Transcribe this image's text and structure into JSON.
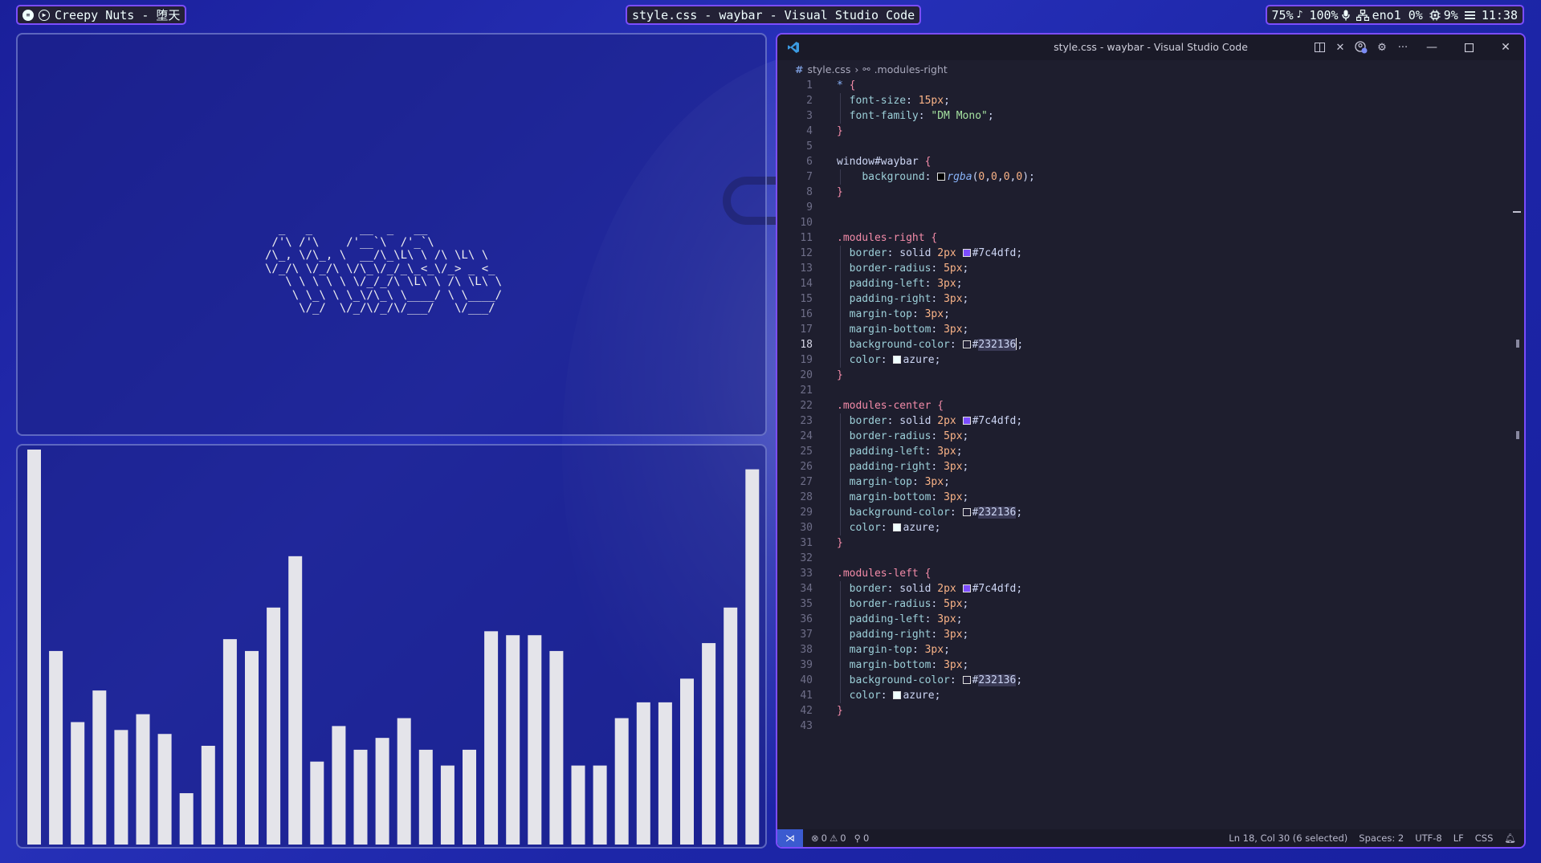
{
  "topbar": {
    "media": {
      "text": "Creepy Nuts - 堕天"
    },
    "window_title": "style.css - waybar - Visual Studio Code",
    "modules": {
      "pulse": "75%",
      "pulse_icon": "♪",
      "mic": "100%",
      "network": "eno1 0%",
      "cpu": "9%",
      "clock": "11:38"
    }
  },
  "ascii_pane": {
    "art": "  _   _       __  _   __ \n /'\\ /'\\    /'__`\\  /'_`\\ \n/\\_, \\/\\_, \\  __/\\_\\L\\ \\ /\\ \\L\\ \\\n\\/_/\\ \\/_/\\ \\/\\_\\/_/_\\_<_\\/_> _ <_\n   \\ \\ \\ \\ \\ \\/_/_/\\ \\L\\ \\ /\\ \\L\\ \\\n    \\ \\_\\ \\ \\_\\/\\_\\ \\____/ \\ \\____/\n     \\/_/  \\/_/\\/_/\\/___/   \\/___/"
  },
  "cava": {
    "bar_color": "#e4e4ea",
    "levels": [
      1.0,
      0.49,
      0.31,
      0.39,
      0.29,
      0.33,
      0.28,
      0.13,
      0.25,
      0.52,
      0.49,
      0.6,
      0.73,
      0.21,
      0.3,
      0.24,
      0.27,
      0.32,
      0.24,
      0.2,
      0.24,
      0.54,
      0.53,
      0.53,
      0.49,
      0.2,
      0.2,
      0.32,
      0.36,
      0.36,
      0.42,
      0.51,
      0.6,
      0.95
    ]
  },
  "vscode": {
    "title": "style.css - waybar - Visual Studio Code",
    "breadcrumb": {
      "file": "style.css",
      "symbol": ".modules-right"
    },
    "status": {
      "errors": "0",
      "warnings": "0",
      "ports": "0",
      "position": "Ln 18, Col 30 (6 selected)",
      "spaces": "Spaces: 2",
      "encoding": "UTF-8",
      "eol": "LF",
      "language": "CSS"
    },
    "active_line": 18,
    "lines": [
      [
        [
          "t-star",
          "*"
        ],
        [
          "t-punc",
          " "
        ],
        [
          "t-brace",
          "{"
        ]
      ],
      [
        [
          "t-punc",
          "  "
        ],
        [
          "t-prop",
          "font-size"
        ],
        [
          "t-punc",
          ": "
        ],
        [
          "t-num",
          "15px"
        ],
        [
          "t-punc",
          ";"
        ]
      ],
      [
        [
          "t-punc",
          "  "
        ],
        [
          "t-prop",
          "font-family"
        ],
        [
          "t-punc",
          ": "
        ],
        [
          "t-str",
          "\"DM Mono\""
        ],
        [
          "t-punc",
          ";"
        ]
      ],
      [
        [
          "t-brace",
          "}"
        ]
      ],
      [],
      [
        [
          "t-kw",
          "window#waybar "
        ],
        [
          "t-brace",
          "{"
        ]
      ],
      [
        [
          "t-punc",
          "    "
        ],
        [
          "t-prop",
          "background"
        ],
        [
          "t-punc",
          ": "
        ],
        [
          "swatch",
          "#000000"
        ],
        [
          "t-fn",
          "rgba"
        ],
        [
          "t-punc",
          "("
        ],
        [
          "t-num",
          "0"
        ],
        [
          "t-punc",
          ","
        ],
        [
          "t-num",
          "0"
        ],
        [
          "t-punc",
          ","
        ],
        [
          "t-num",
          "0"
        ],
        [
          "t-punc",
          ","
        ],
        [
          "t-num",
          "0"
        ],
        [
          "t-punc",
          ");"
        ]
      ],
      [
        [
          "t-brace",
          "}"
        ]
      ],
      [],
      [],
      [
        [
          "t-sel",
          ".modules-right "
        ],
        [
          "t-brace",
          "{"
        ]
      ],
      [
        [
          "t-punc",
          "  "
        ],
        [
          "t-prop",
          "border"
        ],
        [
          "t-punc",
          ": solid "
        ],
        [
          "t-num",
          "2px"
        ],
        [
          "t-punc",
          " "
        ],
        [
          "swatch",
          "#7c4dfd"
        ],
        [
          "t-punc",
          "#7c4dfd;"
        ]
      ],
      [
        [
          "t-punc",
          "  "
        ],
        [
          "t-prop",
          "border-radius"
        ],
        [
          "t-punc",
          ": "
        ],
        [
          "t-num",
          "5px"
        ],
        [
          "t-punc",
          ";"
        ]
      ],
      [
        [
          "t-punc",
          "  "
        ],
        [
          "t-prop",
          "padding-left"
        ],
        [
          "t-punc",
          ": "
        ],
        [
          "t-num",
          "3px"
        ],
        [
          "t-punc",
          ";"
        ]
      ],
      [
        [
          "t-punc",
          "  "
        ],
        [
          "t-prop",
          "padding-right"
        ],
        [
          "t-punc",
          ": "
        ],
        [
          "t-num",
          "3px"
        ],
        [
          "t-punc",
          ";"
        ]
      ],
      [
        [
          "t-punc",
          "  "
        ],
        [
          "t-prop",
          "margin-top"
        ],
        [
          "t-punc",
          ": "
        ],
        [
          "t-num",
          "3px"
        ],
        [
          "t-punc",
          ";"
        ]
      ],
      [
        [
          "t-punc",
          "  "
        ],
        [
          "t-prop",
          "margin-bottom"
        ],
        [
          "t-punc",
          ": "
        ],
        [
          "t-num",
          "3px"
        ],
        [
          "t-punc",
          ";"
        ]
      ],
      [
        [
          "t-punc",
          "  "
        ],
        [
          "t-prop",
          "background-color"
        ],
        [
          "t-punc",
          ": "
        ],
        [
          "swatch",
          "#232136"
        ],
        [
          "t-punc",
          "#"
        ],
        [
          "t-hl",
          "232136"
        ],
        [
          "cursor",
          ""
        ],
        [
          "t-punc",
          ";"
        ]
      ],
      [
        [
          "t-punc",
          "  "
        ],
        [
          "t-prop",
          "color"
        ],
        [
          "t-punc",
          ": "
        ],
        [
          "swatch",
          "#f0ffff"
        ],
        [
          "t-punc",
          "azure;"
        ]
      ],
      [
        [
          "t-brace",
          "}"
        ]
      ],
      [],
      [
        [
          "t-sel",
          ".modules-center "
        ],
        [
          "t-brace",
          "{"
        ]
      ],
      [
        [
          "t-punc",
          "  "
        ],
        [
          "t-prop",
          "border"
        ],
        [
          "t-punc",
          ": solid "
        ],
        [
          "t-num",
          "2px"
        ],
        [
          "t-punc",
          " "
        ],
        [
          "swatch",
          "#7c4dfd"
        ],
        [
          "t-punc",
          "#7c4dfd;"
        ]
      ],
      [
        [
          "t-punc",
          "  "
        ],
        [
          "t-prop",
          "border-radius"
        ],
        [
          "t-punc",
          ": "
        ],
        [
          "t-num",
          "5px"
        ],
        [
          "t-punc",
          ";"
        ]
      ],
      [
        [
          "t-punc",
          "  "
        ],
        [
          "t-prop",
          "padding-left"
        ],
        [
          "t-punc",
          ": "
        ],
        [
          "t-num",
          "3px"
        ],
        [
          "t-punc",
          ";"
        ]
      ],
      [
        [
          "t-punc",
          "  "
        ],
        [
          "t-prop",
          "padding-right"
        ],
        [
          "t-punc",
          ": "
        ],
        [
          "t-num",
          "3px"
        ],
        [
          "t-punc",
          ";"
        ]
      ],
      [
        [
          "t-punc",
          "  "
        ],
        [
          "t-prop",
          "margin-top"
        ],
        [
          "t-punc",
          ": "
        ],
        [
          "t-num",
          "3px"
        ],
        [
          "t-punc",
          ";"
        ]
      ],
      [
        [
          "t-punc",
          "  "
        ],
        [
          "t-prop",
          "margin-bottom"
        ],
        [
          "t-punc",
          ": "
        ],
        [
          "t-num",
          "3px"
        ],
        [
          "t-punc",
          ";"
        ]
      ],
      [
        [
          "t-punc",
          "  "
        ],
        [
          "t-prop",
          "background-color"
        ],
        [
          "t-punc",
          ": "
        ],
        [
          "swatch",
          "#232136"
        ],
        [
          "t-punc",
          "#"
        ],
        [
          "t-hl",
          "232136"
        ],
        [
          "t-punc",
          ";"
        ]
      ],
      [
        [
          "t-punc",
          "  "
        ],
        [
          "t-prop",
          "color"
        ],
        [
          "t-punc",
          ": "
        ],
        [
          "swatch",
          "#f0ffff"
        ],
        [
          "t-punc",
          "azure;"
        ]
      ],
      [
        [
          "t-brace",
          "}"
        ]
      ],
      [],
      [
        [
          "t-sel",
          ".modules-left "
        ],
        [
          "t-brace",
          "{"
        ]
      ],
      [
        [
          "t-punc",
          "  "
        ],
        [
          "t-prop",
          "border"
        ],
        [
          "t-punc",
          ": solid "
        ],
        [
          "t-num",
          "2px"
        ],
        [
          "t-punc",
          " "
        ],
        [
          "swatch",
          "#7c4dfd"
        ],
        [
          "t-punc",
          "#7c4dfd;"
        ]
      ],
      [
        [
          "t-punc",
          "  "
        ],
        [
          "t-prop",
          "border-radius"
        ],
        [
          "t-punc",
          ": "
        ],
        [
          "t-num",
          "5px"
        ],
        [
          "t-punc",
          ";"
        ]
      ],
      [
        [
          "t-punc",
          "  "
        ],
        [
          "t-prop",
          "padding-left"
        ],
        [
          "t-punc",
          ": "
        ],
        [
          "t-num",
          "3px"
        ],
        [
          "t-punc",
          ";"
        ]
      ],
      [
        [
          "t-punc",
          "  "
        ],
        [
          "t-prop",
          "padding-right"
        ],
        [
          "t-punc",
          ": "
        ],
        [
          "t-num",
          "3px"
        ],
        [
          "t-punc",
          ";"
        ]
      ],
      [
        [
          "t-punc",
          "  "
        ],
        [
          "t-prop",
          "margin-top"
        ],
        [
          "t-punc",
          ": "
        ],
        [
          "t-num",
          "3px"
        ],
        [
          "t-punc",
          ";"
        ]
      ],
      [
        [
          "t-punc",
          "  "
        ],
        [
          "t-prop",
          "margin-bottom"
        ],
        [
          "t-punc",
          ": "
        ],
        [
          "t-num",
          "3px"
        ],
        [
          "t-punc",
          ";"
        ]
      ],
      [
        [
          "t-punc",
          "  "
        ],
        [
          "t-prop",
          "background-color"
        ],
        [
          "t-punc",
          ": "
        ],
        [
          "swatch",
          "#232136"
        ],
        [
          "t-punc",
          "#"
        ],
        [
          "t-hl",
          "232136"
        ],
        [
          "t-punc",
          ";"
        ]
      ],
      [
        [
          "t-punc",
          "  "
        ],
        [
          "t-prop",
          "color"
        ],
        [
          "t-punc",
          ": "
        ],
        [
          "swatch",
          "#f0ffff"
        ],
        [
          "t-punc",
          "azure;"
        ]
      ],
      [
        [
          "t-brace",
          "}"
        ]
      ],
      []
    ]
  },
  "colors": {
    "accent": "#7c4dfd",
    "module_bg": "#232136",
    "module_fg": "#f0ffff"
  }
}
